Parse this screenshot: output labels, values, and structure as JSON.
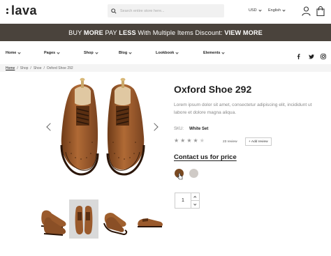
{
  "header": {
    "logo": "lava",
    "search_placeholder": "Search entire store here...",
    "currency": "USD",
    "language": "English"
  },
  "promo": {
    "pre": "BUY ",
    "b1": "MORE",
    "mid1": " PAY ",
    "b2": "LESS",
    "mid2": " With Multiple Items Discount: ",
    "b3": "VIEW MORE"
  },
  "nav": {
    "items": [
      "Home",
      "Pages",
      "Shop",
      "Blog",
      "Lookbook",
      "Elements"
    ],
    "social": [
      "facebook-icon",
      "twitter-icon",
      "instagram-icon"
    ]
  },
  "breadcrumb": [
    "Home",
    "Shop",
    "Shoe",
    "Oxford Shoe 292"
  ],
  "breadcrumb_sep": "/",
  "product": {
    "title": "Oxford Shoe 292",
    "description": "Lorem ipsum dolor sit amet, consectetur adipiscing elit, incididunt ut labore et dolore magna aliqua.",
    "sku_label": "SKU:",
    "sku_value": "White Set",
    "rating": 4,
    "rating_max": 5,
    "review_count": "23 review",
    "add_review": "+ Add review",
    "contact": "Contact us for price",
    "quantity": "1",
    "swatches": [
      "#7a4a22",
      "#cfcac6"
    ],
    "shoe_color": "#9a5a2c"
  }
}
